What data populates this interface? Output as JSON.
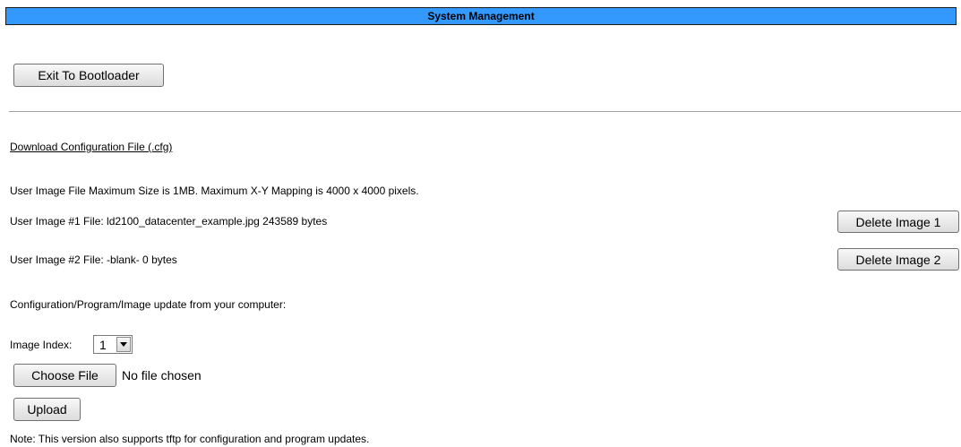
{
  "header": {
    "title": "System Management"
  },
  "actions": {
    "exit_bootloader": "Exit To Bootloader"
  },
  "download": {
    "link_text": "Download Configuration File (.cfg)"
  },
  "images": {
    "info": "User Image File Maximum Size is 1MB. Maximum X-Y Mapping is 4000 x 4000 pixels.",
    "image1": {
      "label": "User Image #1 File: ld2100_datacenter_example.jpg 243589 bytes",
      "delete_label": "Delete Image 1"
    },
    "image2": {
      "label": "User Image #2 File: -blank- 0 bytes",
      "delete_label": "Delete Image 2"
    }
  },
  "update": {
    "heading": "Configuration/Program/Image update from your computer:",
    "image_index_label": "Image Index:",
    "image_index_value": "1",
    "choose_file_label": "Choose File",
    "file_status": "No file chosen",
    "upload_label": "Upload"
  },
  "note": "Note: This version also supports tftp for configuration and program updates.",
  "icons": {
    "dropdown": "chevron-down-icon"
  }
}
